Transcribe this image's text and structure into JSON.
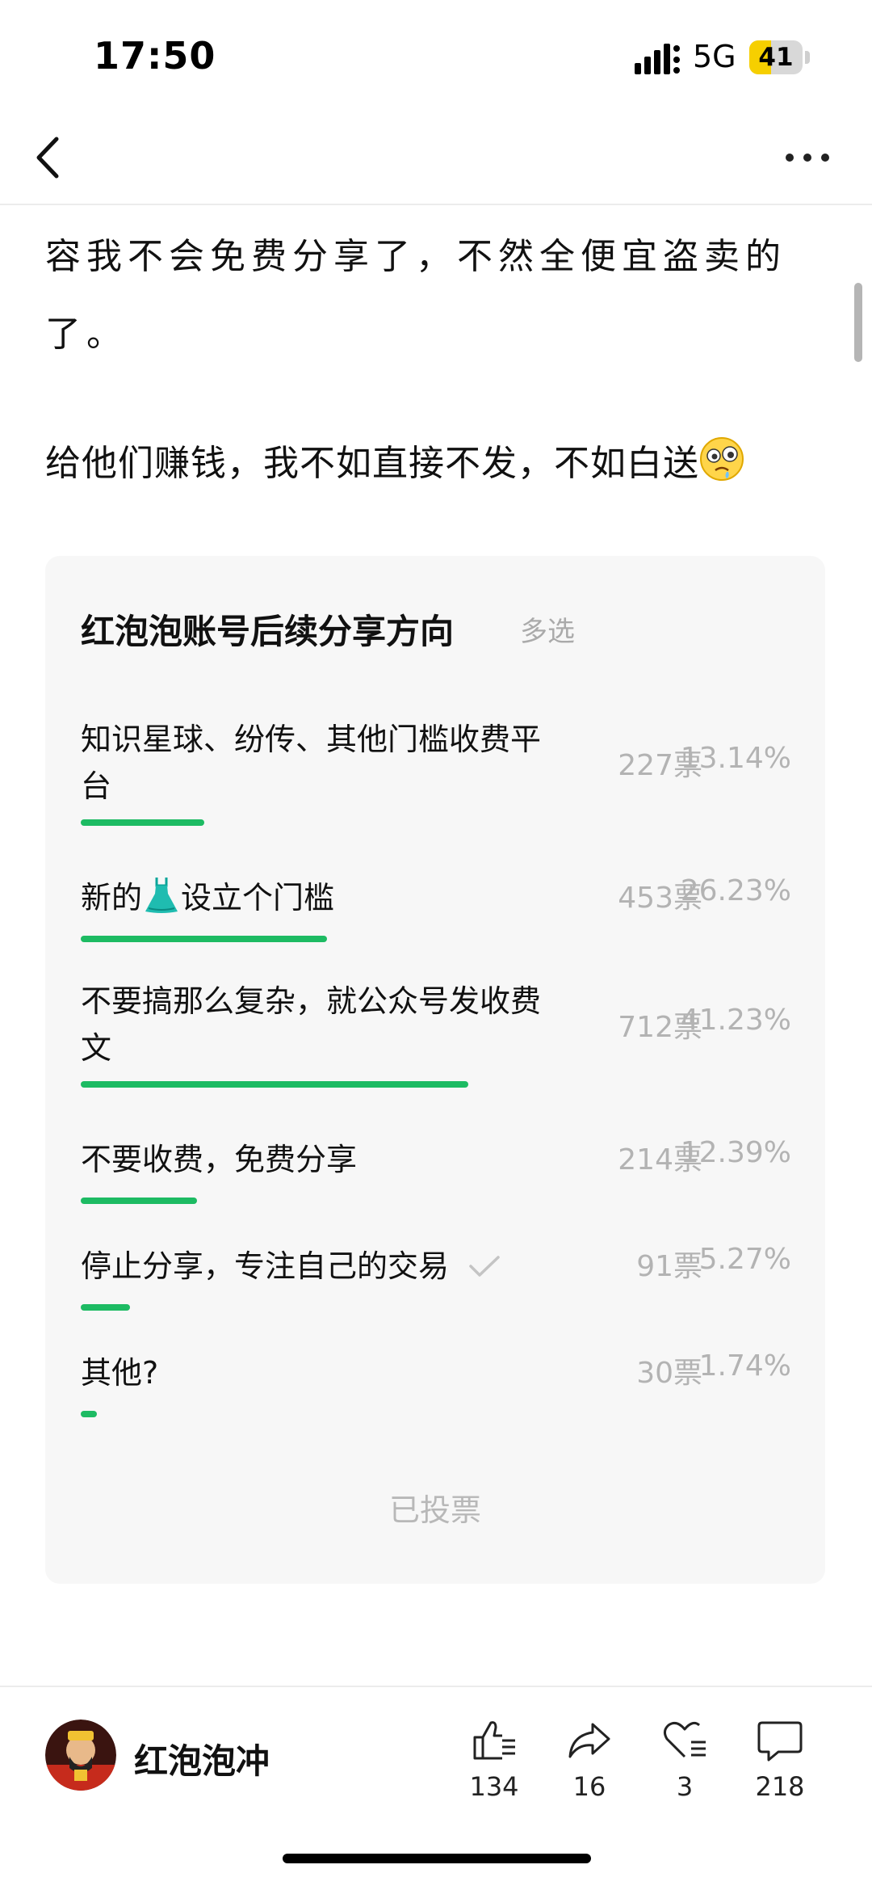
{
  "status_bar": {
    "time": "17:50",
    "network": "5G",
    "battery": "41",
    "battery_level": 0.41,
    "battery_color": "#f6cf00"
  },
  "nav": {
    "back_icon": "chevron-left-icon",
    "more_icon": "ellipsis-icon"
  },
  "article": {
    "paragraph_1": "容我不会免费分享了，不然全便宜盗卖的了。",
    "paragraph_2": "给他们赚钱，我不如直接不发，不如白送",
    "paragraph_2_emoji": "woozy-face-emoji"
  },
  "poll": {
    "title": "红泡泡账号后续分享方向",
    "mode": "多选",
    "bar_color": "#1dbb63",
    "options": [
      {
        "label": "知识星球、纷传、其他门槛收费平台",
        "votes": "227票",
        "percent": "13.14%",
        "fraction": 0.1314
      },
      {
        "label_before": "新的",
        "label_icon": "dress-icon",
        "label_after": "设立个门槛",
        "votes": "453票",
        "percent": "26.23%",
        "fraction": 0.2623
      },
      {
        "label": "不要搞那么复杂，就公众号发收费文",
        "votes": "712票",
        "percent": "41.23%",
        "fraction": 0.4123
      },
      {
        "label": "不要收费，免费分享",
        "votes": "214票",
        "percent": "12.39%",
        "fraction": 0.1239
      },
      {
        "label": "停止分享，专注自己的交易",
        "votes": "91票",
        "percent": "5.27%",
        "fraction": 0.0527,
        "selected": true
      },
      {
        "label": "其他?",
        "votes": "30票",
        "percent": "1.74%",
        "fraction": 0.0174
      }
    ],
    "status": "已投票"
  },
  "author": {
    "name": "红泡泡冲",
    "avatar_icon": "avatar"
  },
  "actions": {
    "like": {
      "icon": "thumbs-up-icon",
      "count": "134"
    },
    "share": {
      "icon": "share-arrow-icon",
      "count": "16"
    },
    "favorite": {
      "icon": "heart-icon",
      "count": "3"
    },
    "comment": {
      "icon": "comment-bubble-icon",
      "count": "218"
    }
  }
}
